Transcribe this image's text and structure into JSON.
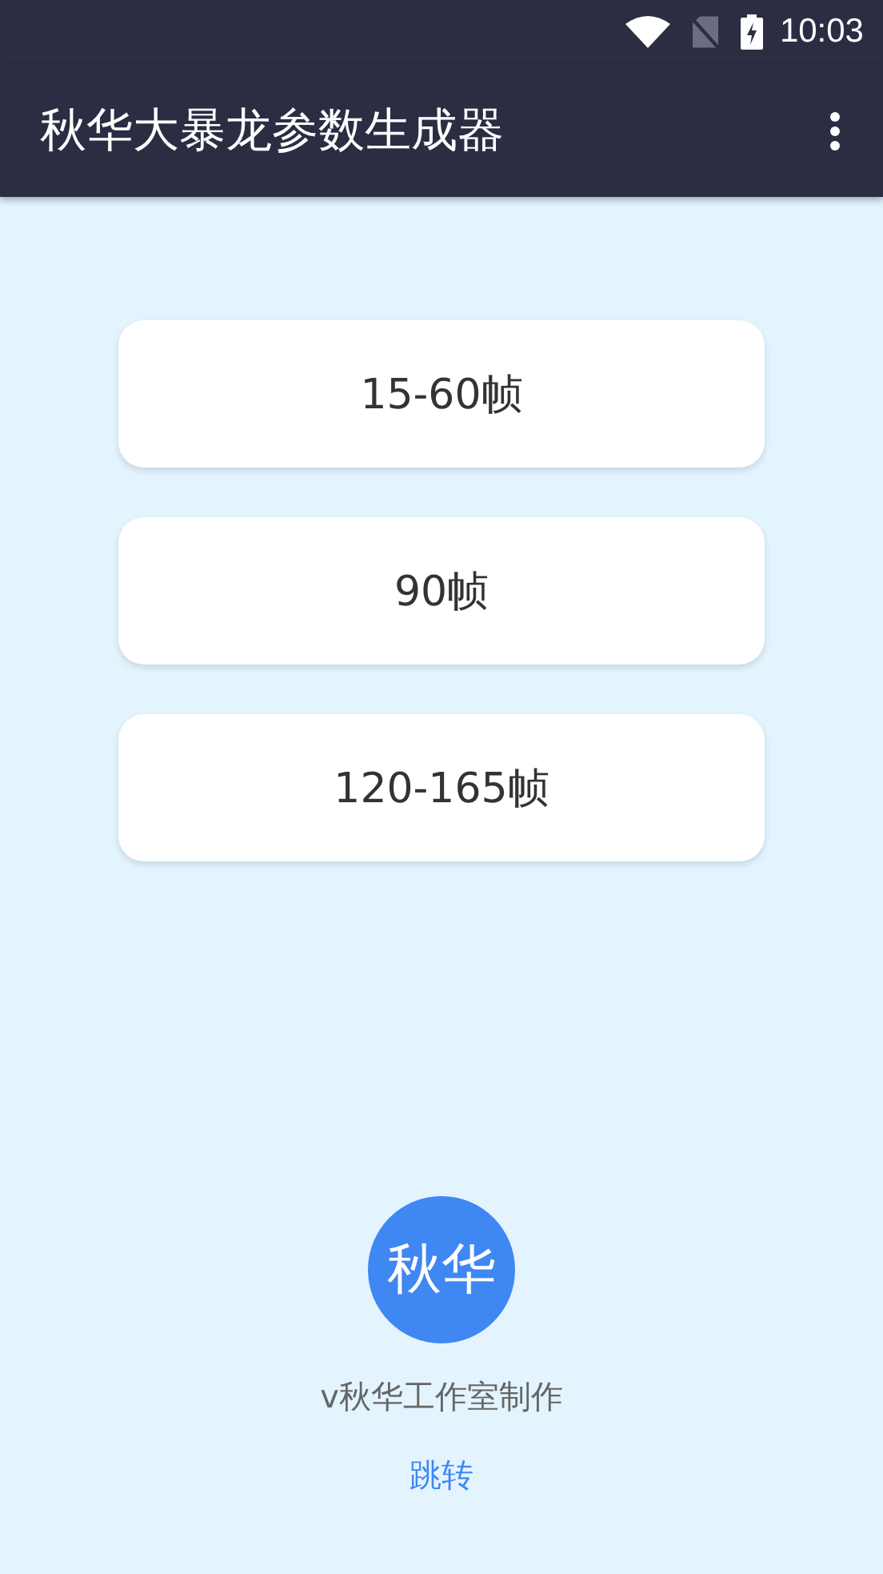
{
  "status_bar": {
    "time": "10:03"
  },
  "app_bar": {
    "title": "秋华大暴龙参数生成器"
  },
  "buttons": [
    {
      "label": "15-60帧"
    },
    {
      "label": "90帧"
    },
    {
      "label": "120-165帧"
    }
  ],
  "footer": {
    "avatar": "秋华",
    "credit": "v秋华工作室制作",
    "link": "跳转"
  }
}
